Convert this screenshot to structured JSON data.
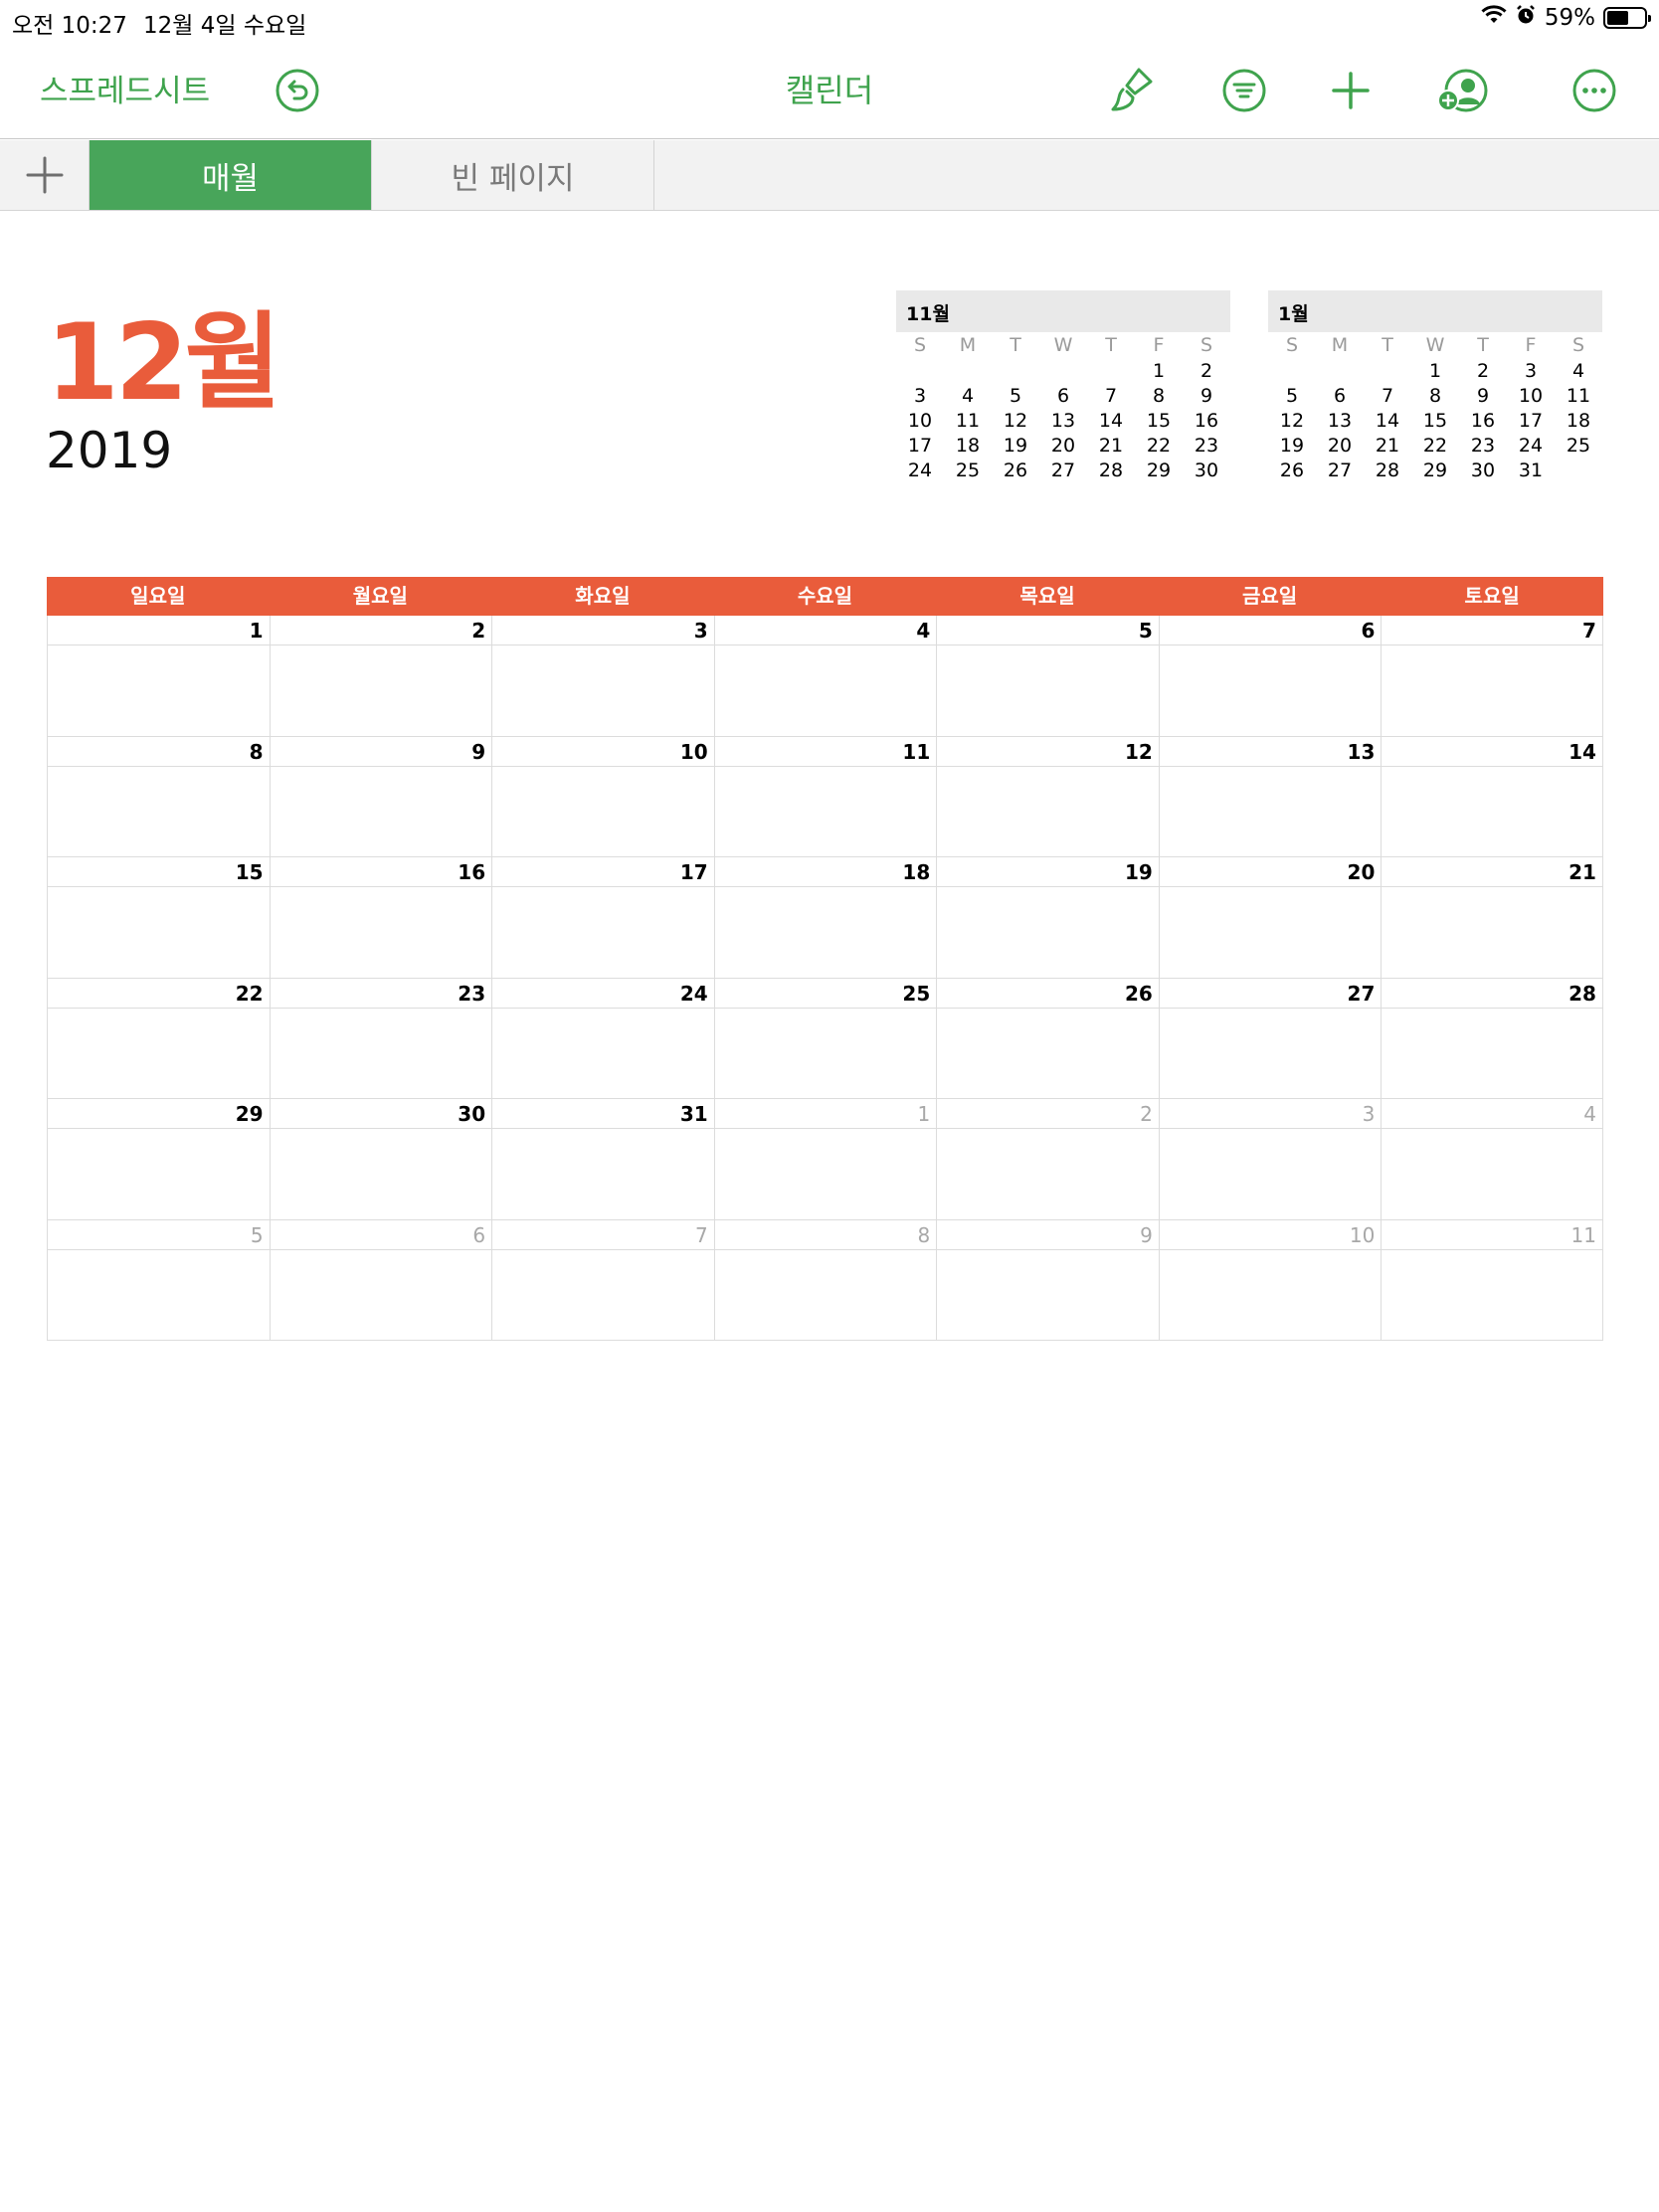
{
  "status_bar": {
    "time": "오전 10:27",
    "date": "12월 4일 수요일",
    "battery": "59%",
    "battery_level": 0.59,
    "icons": [
      "wifi-icon",
      "alarm-icon",
      "battery-icon"
    ]
  },
  "toolbar": {
    "back_label": "스프레드시트",
    "title": "캘린더",
    "undo_icon": "undo-icon",
    "buttons": [
      "paintbrush-icon",
      "filter-icon",
      "plus-icon",
      "collaborate-icon",
      "more-icon"
    ]
  },
  "tabs": {
    "add_icon": "plus-icon",
    "items": [
      {
        "label": "매월",
        "active": true
      },
      {
        "label": "빈 페이지",
        "active": false
      }
    ]
  },
  "month": {
    "title": "12월",
    "year": "2019"
  },
  "mini_calendars": [
    {
      "title": "11월",
      "dow": [
        "S",
        "M",
        "T",
        "W",
        "T",
        "F",
        "S"
      ],
      "weeks": [
        [
          "",
          "",
          "",
          "",
          "",
          "1",
          "2"
        ],
        [
          "3",
          "4",
          "5",
          "6",
          "7",
          "8",
          "9"
        ],
        [
          "10",
          "11",
          "12",
          "13",
          "14",
          "15",
          "16"
        ],
        [
          "17",
          "18",
          "19",
          "20",
          "21",
          "22",
          "23"
        ],
        [
          "24",
          "25",
          "26",
          "27",
          "28",
          "29",
          "30"
        ]
      ]
    },
    {
      "title": "1월",
      "dow": [
        "S",
        "M",
        "T",
        "W",
        "T",
        "F",
        "S"
      ],
      "weeks": [
        [
          "",
          "",
          "",
          "1",
          "2",
          "3",
          "4"
        ],
        [
          "5",
          "6",
          "7",
          "8",
          "9",
          "10",
          "11"
        ],
        [
          "12",
          "13",
          "14",
          "15",
          "16",
          "17",
          "18"
        ],
        [
          "19",
          "20",
          "21",
          "22",
          "23",
          "24",
          "25"
        ],
        [
          "26",
          "27",
          "28",
          "29",
          "30",
          "31",
          ""
        ]
      ]
    }
  ],
  "calendar": {
    "weekdays": [
      "일요일",
      "월요일",
      "화요일",
      "수요일",
      "목요일",
      "금요일",
      "토요일"
    ],
    "weeks": [
      [
        {
          "d": "1"
        },
        {
          "d": "2"
        },
        {
          "d": "3"
        },
        {
          "d": "4"
        },
        {
          "d": "5"
        },
        {
          "d": "6"
        },
        {
          "d": "7"
        }
      ],
      [
        {
          "d": "8"
        },
        {
          "d": "9"
        },
        {
          "d": "10"
        },
        {
          "d": "11"
        },
        {
          "d": "12"
        },
        {
          "d": "13"
        },
        {
          "d": "14"
        }
      ],
      [
        {
          "d": "15"
        },
        {
          "d": "16"
        },
        {
          "d": "17"
        },
        {
          "d": "18"
        },
        {
          "d": "19"
        },
        {
          "d": "20"
        },
        {
          "d": "21"
        }
      ],
      [
        {
          "d": "22"
        },
        {
          "d": "23"
        },
        {
          "d": "24"
        },
        {
          "d": "25"
        },
        {
          "d": "26"
        },
        {
          "d": "27"
        },
        {
          "d": "28"
        }
      ],
      [
        {
          "d": "29"
        },
        {
          "d": "30"
        },
        {
          "d": "31"
        },
        {
          "d": "1",
          "other": true
        },
        {
          "d": "2",
          "other": true
        },
        {
          "d": "3",
          "other": true
        },
        {
          "d": "4",
          "other": true
        }
      ],
      [
        {
          "d": "5",
          "other": true
        },
        {
          "d": "6",
          "other": true
        },
        {
          "d": "7",
          "other": true
        },
        {
          "d": "8",
          "other": true
        },
        {
          "d": "9",
          "other": true
        },
        {
          "d": "10",
          "other": true
        },
        {
          "d": "11",
          "other": true
        }
      ]
    ]
  },
  "colors": {
    "accent_green": "#3fa34d",
    "tab_active_green": "#48a55a",
    "calendar_orange": "#e95c3b"
  }
}
